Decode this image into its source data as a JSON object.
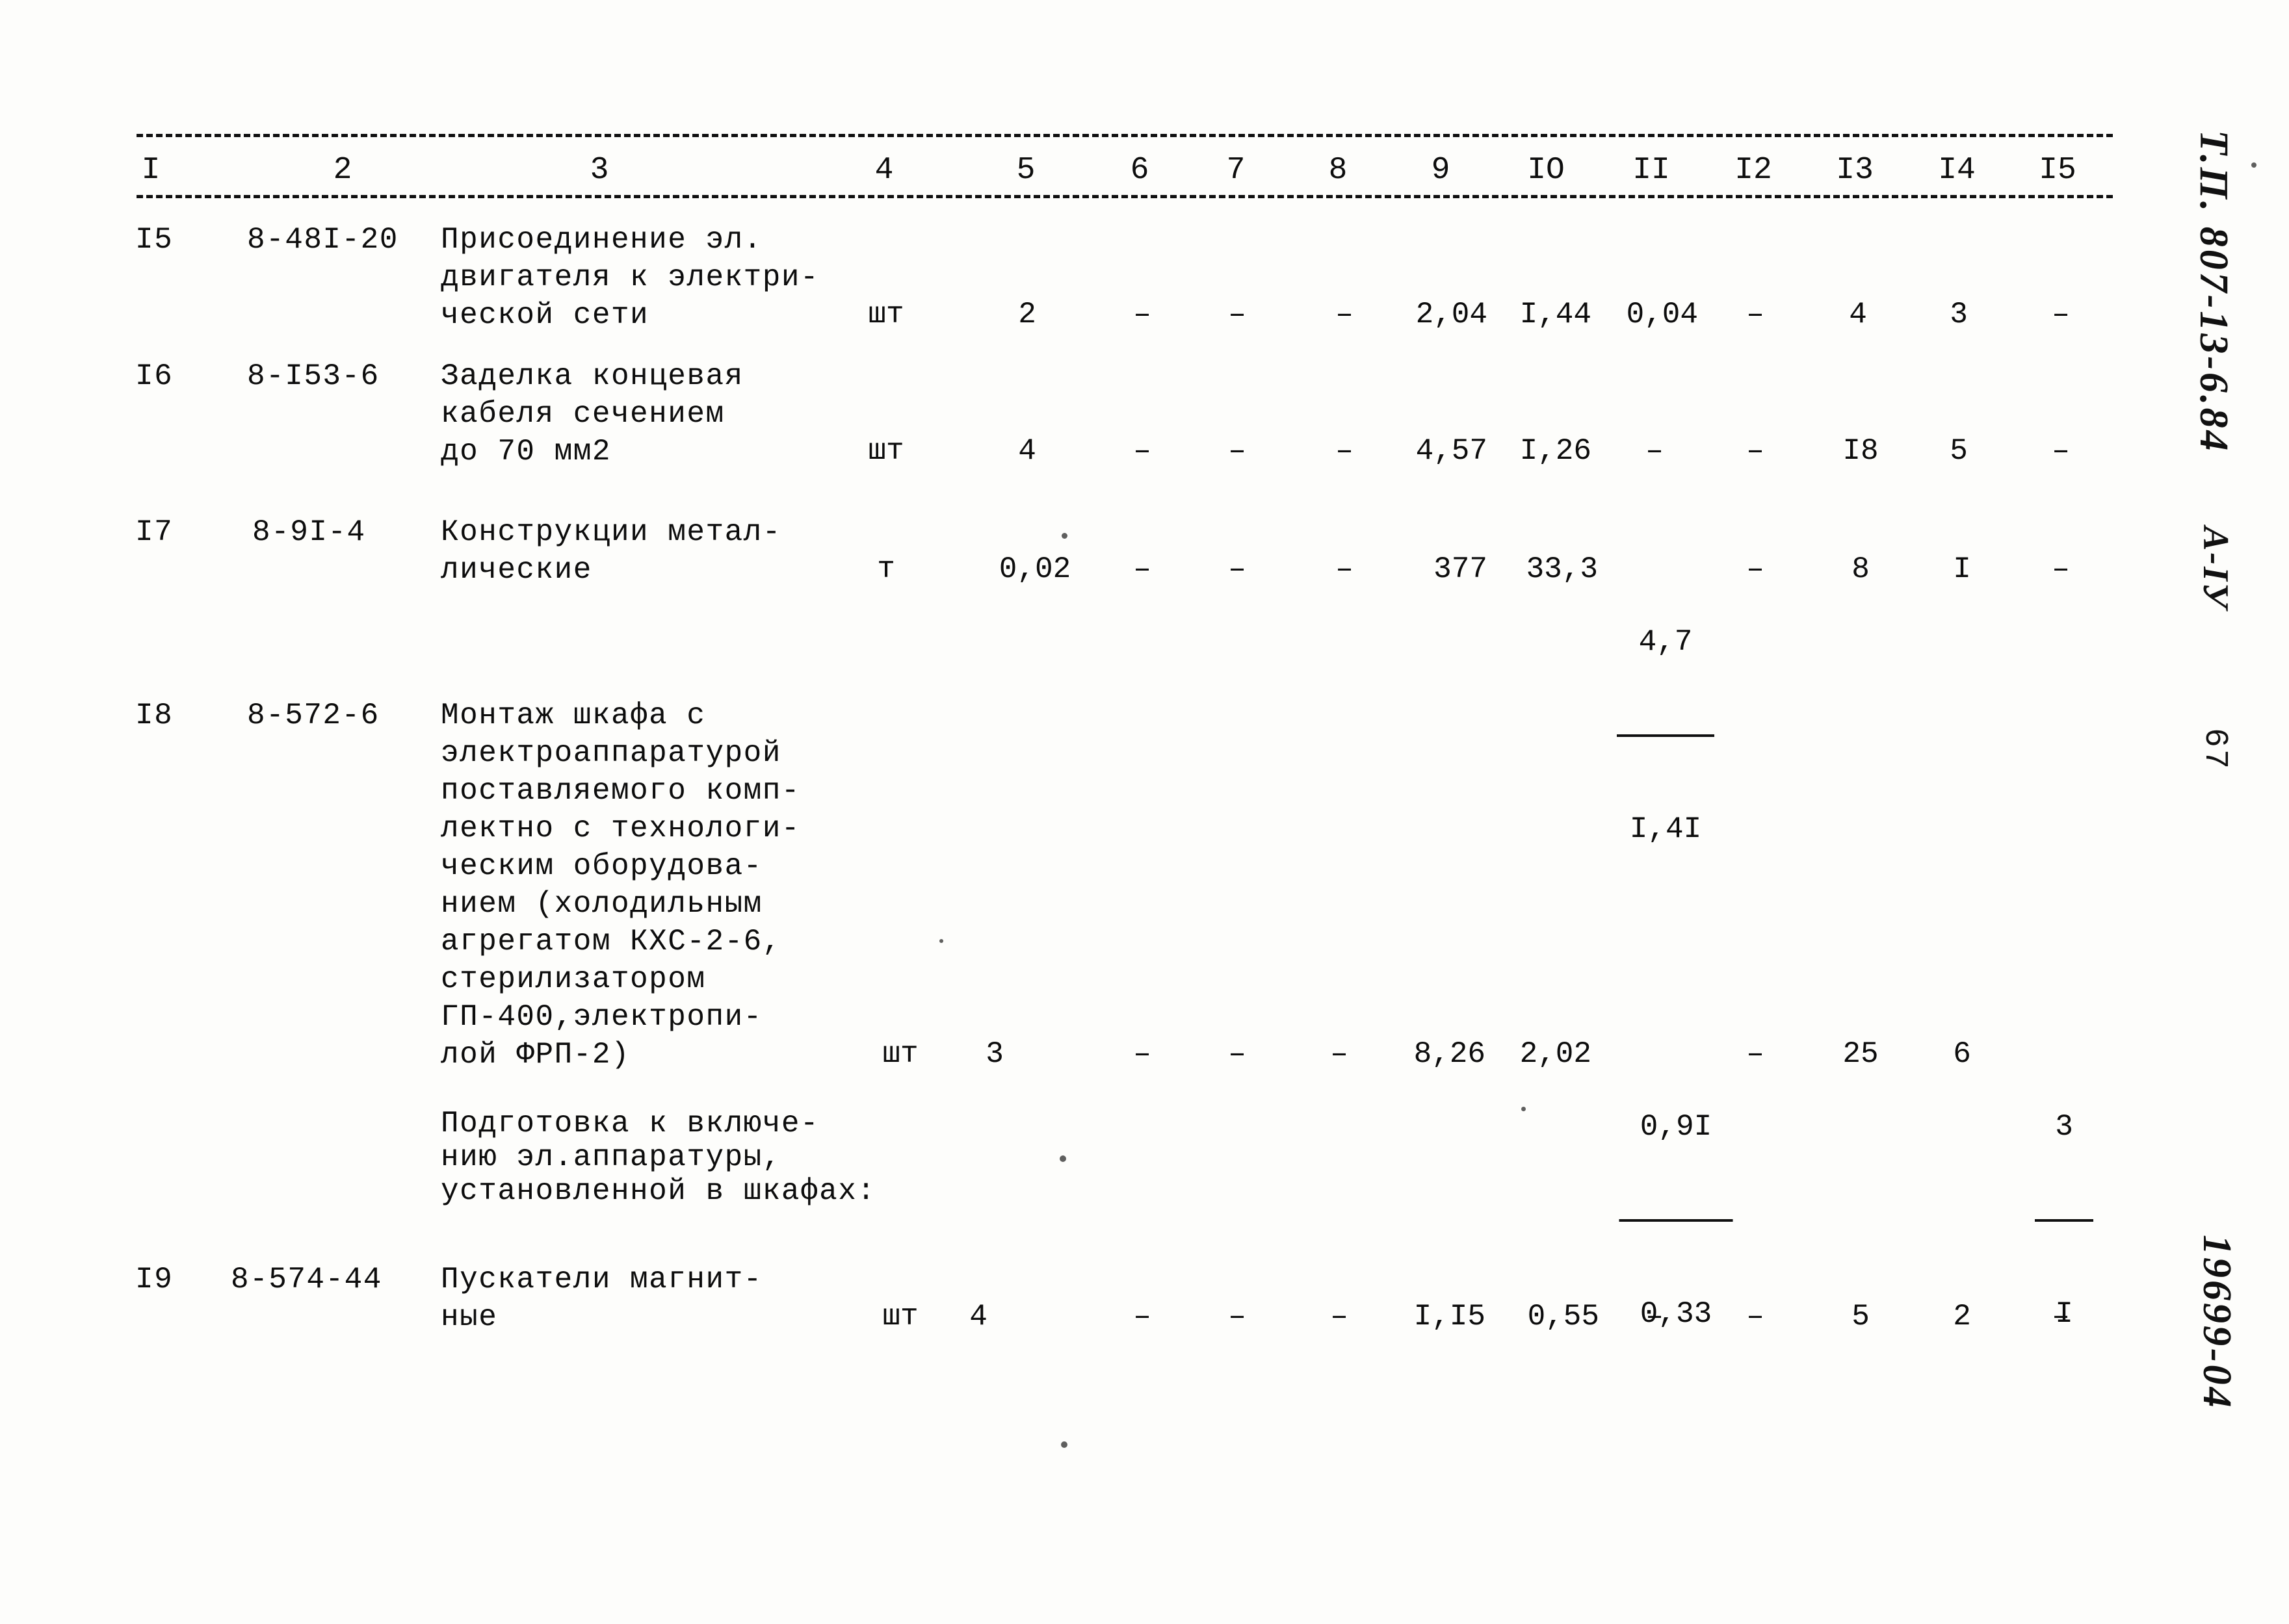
{
  "document": {
    "type": "soviet-construction-estimate-sheet",
    "page_number": "67",
    "margin": {
      "project_code": "Т.П. 807-13-6.84",
      "section_code": "А-IУ",
      "archive_stamp": "19699-04"
    }
  },
  "table": {
    "column_headers": [
      "I",
      "2",
      "3",
      "4",
      "5",
      "6",
      "7",
      "8",
      "9",
      "IO",
      "II",
      "I2",
      "I3",
      "I4",
      "I5"
    ],
    "rows": [
      {
        "no": "I5",
        "code": "8-48I-20",
        "description_lines": [
          "Присоединение эл.",
          "двигателя к электри-",
          "ческой сети"
        ],
        "unit": "шт",
        "qty": "2",
        "c6": "–",
        "c7": "–",
        "c8": "–",
        "c9": "2,04",
        "c10": "I,44",
        "c11": "0,04",
        "c11_den": "",
        "c12": "–",
        "c13": "4",
        "c14": "3",
        "c15": "–",
        "c15_den": ""
      },
      {
        "no": "I6",
        "code": "8-I53-6",
        "description_lines": [
          "Заделка концевая",
          "кабеля сечением",
          "до 70 мм2"
        ],
        "unit": "шт",
        "qty": "4",
        "c6": "–",
        "c7": "–",
        "c8": "–",
        "c9": "4,57",
        "c10": "I,26",
        "c11": "–",
        "c11_den": "",
        "c12": "–",
        "c13": "I8",
        "c14": "5",
        "c15": "–",
        "c15_den": ""
      },
      {
        "no": "I7",
        "code": "8-9I-4",
        "description_lines": [
          "Конструкции метал-",
          "лические"
        ],
        "unit": "т",
        "qty": "0,02",
        "c6": "–",
        "c7": "–",
        "c8": "–",
        "c9": "377",
        "c10": "33,3",
        "c11": "4,7",
        "c11_den": "I,4I",
        "c12": "–",
        "c13": "8",
        "c14": "I",
        "c15": "–",
        "c15_den": ""
      },
      {
        "no": "I8",
        "code": "8-572-6",
        "description_lines": [
          "Монтаж шкафа с",
          "электроаппаратурой",
          "поставляемого комп-",
          "лектно с технологи-",
          "ческим оборудова-",
          "нием (холодильным",
          "агрегатом КХС-2-6,",
          "стерилизатором",
          "ГП-400,электропи-",
          "лой ФРП-2)"
        ],
        "unit": "шт",
        "qty": "3",
        "c6": "–",
        "c7": "–",
        "c8": "–",
        "c9": "8,26",
        "c10": "2,02",
        "c11": "0,9I",
        "c11_den": "0,33",
        "c12": "–",
        "c13": "25",
        "c14": "6",
        "c15": "3",
        "c15_den": "I"
      },
      {
        "no": "I9",
        "code": "8-574-44",
        "description_lines": [
          "Пускатели магнит-",
          "ные"
        ],
        "unit": "шт",
        "qty": "4",
        "c6": "–",
        "c7": "–",
        "c8": "–",
        "c9": "I,I5",
        "c10": "0,55",
        "c11": "–",
        "c11_den": "",
        "c12": "–",
        "c13": "5",
        "c14": "2",
        "c15": "–",
        "c15_den": ""
      }
    ],
    "subheading": {
      "lines": [
        "Подготовка к включе-",
        "нию эл.аппаратуры,",
        "установленной в шкафах:"
      ]
    }
  }
}
